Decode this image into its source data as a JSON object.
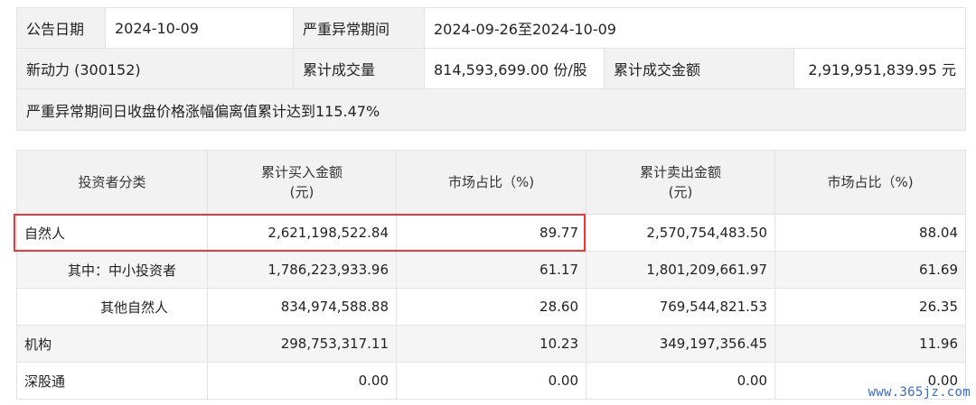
{
  "summary": {
    "announce_date_label": "公告日期",
    "announce_date": "2024-10-09",
    "period_label": "严重异常期间",
    "period": "2024-09-26至2024-10-09",
    "stock_name": "新动力 (300152)",
    "volume_label": "累计成交量",
    "volume": "814,593,699.00 份/股",
    "amount_label": "累计成交金额",
    "amount": "2,919,951,839.95 元",
    "note": "严重异常期间日收盘价格涨幅偏离值累计达到115.47%"
  },
  "detail": {
    "headers": {
      "category": "投资者分类",
      "buy_amount_line1": "累计买入金额",
      "buy_amount_line2": "(元)",
      "buy_share": "市场占比（%)",
      "sell_amount_line1": "累计卖出金额",
      "sell_amount_line2": "(元)",
      "sell_share": "市场占比（%)"
    },
    "rows": [
      {
        "category": "自然人",
        "buy": "2,621,198,522.84",
        "buy_pct": "89.77",
        "sell": "2,570,754,483.50",
        "sell_pct": "88.04"
      },
      {
        "category": "其中：中小投资者",
        "buy": "1,786,223,933.96",
        "buy_pct": "61.17",
        "sell": "1,801,209,661.97",
        "sell_pct": "61.69"
      },
      {
        "category": "其他自然人",
        "buy": "834,974,588.88",
        "buy_pct": "28.60",
        "sell": "769,544,821.53",
        "sell_pct": "26.35"
      },
      {
        "category": "机构",
        "buy": "298,753,317.11",
        "buy_pct": "10.23",
        "sell": "349,197,356.45",
        "sell_pct": "11.96"
      },
      {
        "category": "深股通",
        "buy": "0.00",
        "buy_pct": "0.00",
        "sell": "0.00",
        "sell_pct": "0.00"
      }
    ]
  },
  "watermark": "www.365jz.com",
  "colors": {
    "highlight_border": "#e53a3a",
    "header_bg": "#f2f2f2",
    "watermark": "#3a6bbf"
  }
}
